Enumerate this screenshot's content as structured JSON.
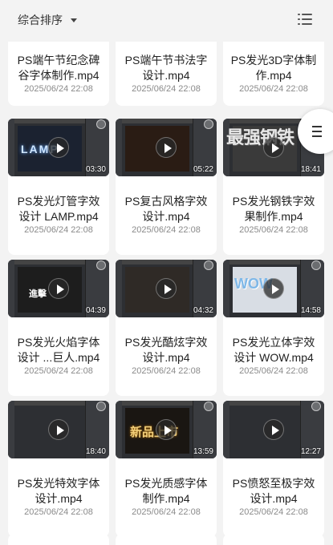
{
  "toolbar": {
    "sort_label": "综合排序"
  },
  "videos": [
    {
      "title": "PS端午节纪念碑谷字体制作.mp4",
      "date": "2025/06/24 22:08",
      "duration": "",
      "art": ""
    },
    {
      "title": "PS端午节书法字设计.mp4",
      "date": "2025/06/24 22:08",
      "duration": "",
      "art": ""
    },
    {
      "title": "PS发光3D字体制作.mp4",
      "date": "2025/06/24 22:08",
      "duration": "",
      "art": ""
    },
    {
      "title": "PS发光灯管字效设计 LAMP.mp4",
      "date": "2025/06/24 22:08",
      "duration": "03:30",
      "art": "LAMP"
    },
    {
      "title": "PS复古风格字效设计.mp4",
      "date": "2025/06/24 22:08",
      "duration": "05:22",
      "art": ""
    },
    {
      "title": "PS发光钢铁字效果制作.mp4",
      "date": "2025/06/24 22:08",
      "duration": "18:41",
      "art": "最强钢铁"
    },
    {
      "title": "PS发光火焰字体设计 ...巨人.mp4",
      "date": "2025/06/24 22:08",
      "duration": "04:39",
      "art": "進擊"
    },
    {
      "title": "PS发光酷炫字效设计.mp4",
      "date": "2025/06/24 22:08",
      "duration": "04:32",
      "art": ""
    },
    {
      "title": "PS发光立体字效设计 WOW.mp4",
      "date": "2025/06/24 22:08",
      "duration": "14:58",
      "art": "WOW"
    },
    {
      "title": "PS发光特效字体设计.mp4",
      "date": "2025/06/24 22:08",
      "duration": "18:40",
      "art": ""
    },
    {
      "title": "PS发光质感字体制作.mp4",
      "date": "2025/06/24 22:08",
      "duration": "13:59",
      "art": "新品上市"
    },
    {
      "title": "PS愤怒至极字效设计.mp4",
      "date": "2025/06/24 22:08",
      "duration": "12:27",
      "art": ""
    }
  ],
  "icons": {
    "sort_caret": "caret-down-icon",
    "view_toggle": "list-view-icon",
    "float_menu": "menu-icon",
    "play": "play-icon"
  }
}
